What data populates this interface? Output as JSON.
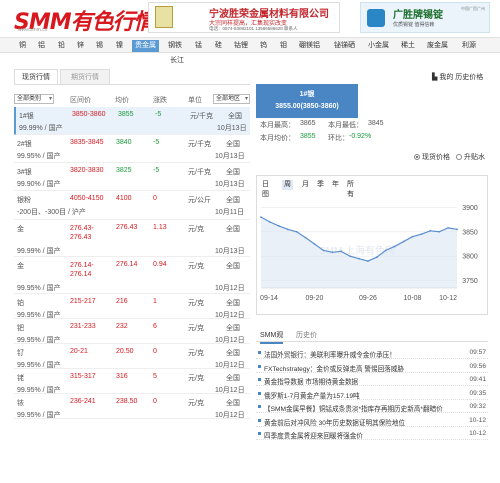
{
  "header": {
    "logo": "SMM有色行情",
    "logo_sub": "www.smm.cn",
    "ad1_title": "宁波胜荣金属材料有限公司",
    "ad1_slogan": "大宗同样提高，汇集现实改变",
    "ad1_contact": "电话：0574-83082101 13586586628 联系人",
    "ad2_title": "广胜牌锡锭",
    "ad2_sub": "优质锡锭 值得信赖",
    "ad2_tag": "中国广西广州"
  },
  "nav": {
    "items": [
      "铜",
      "铝",
      "铅",
      "锌",
      "锡",
      "镍",
      "贵金属",
      "钢铁",
      "锰",
      "硅",
      "钴锂",
      "钨",
      "钼",
      "硼镁铝",
      "铋锑硒",
      "小金属",
      "稀土",
      "废金属",
      "利源"
    ],
    "sub": "长江"
  },
  "tabs": {
    "spot": "现货行情",
    "futures": "期货行情"
  },
  "favorite": "我的 历史价格",
  "table": {
    "category_select": "全部类别",
    "region_select": "全部地区",
    "headers": [
      "区间价",
      "均价",
      "涨跌",
      "单位",
      "日期"
    ],
    "rows": [
      {
        "name": "1#银",
        "range": "3850-3860",
        "avg": "3855",
        "chg": "-5",
        "unit": "元/千克",
        "region": "全国",
        "spec": "99.99% / 国产",
        "date": "10月13日",
        "selected": true,
        "dir": "down"
      },
      {
        "name": "2#银",
        "range": "3835-3845",
        "avg": "3840",
        "chg": "-5",
        "unit": "元/千克",
        "region": "全国",
        "spec": "99.95% / 国产",
        "date": "10月13日",
        "selected": false,
        "dir": "down"
      },
      {
        "name": "3#银",
        "range": "3820-3830",
        "avg": "3825",
        "chg": "-5",
        "unit": "元/千克",
        "region": "全国",
        "spec": "99.90% / 国产",
        "date": "10月13日",
        "selected": false,
        "dir": "down"
      },
      {
        "name": "银粉",
        "range": "4050-4150",
        "avg": "4100",
        "chg": "0",
        "unit": "元/公斤",
        "region": "全国",
        "spec": "-200目、-300目 / 沪产",
        "date": "10月11日",
        "selected": false,
        "dir": "flat"
      },
      {
        "name": "金",
        "range": "276.43-276.43",
        "avg": "276.43",
        "chg": "1.13",
        "unit": "元/克",
        "region": "全国",
        "spec": "99.99% / 国产",
        "date": "10月13日",
        "selected": false,
        "dir": "up"
      },
      {
        "name": "金",
        "range": "276.14-276.14",
        "avg": "276.14",
        "chg": "0.94",
        "unit": "元/克",
        "region": "全国",
        "spec": "99.95% / 国产",
        "date": "10月12日",
        "selected": false,
        "dir": "up"
      },
      {
        "name": "铂",
        "range": "215-217",
        "avg": "216",
        "chg": "1",
        "unit": "元/克",
        "region": "全国",
        "spec": "99.95% / 国产",
        "date": "10月12日",
        "selected": false,
        "dir": "up"
      },
      {
        "name": "钯",
        "range": "231-233",
        "avg": "232",
        "chg": "6",
        "unit": "元/克",
        "region": "全国",
        "spec": "99.95% / 国产",
        "date": "10月12日",
        "selected": false,
        "dir": "up"
      },
      {
        "name": "钌",
        "range": "20-21",
        "avg": "20.50",
        "chg": "0",
        "unit": "元/克",
        "region": "全国",
        "spec": "99.95% / 国产",
        "date": "10月12日",
        "selected": false,
        "dir": "flat"
      },
      {
        "name": "铑",
        "range": "315-317",
        "avg": "316",
        "chg": "5",
        "unit": "元/克",
        "region": "全国",
        "spec": "99.95% / 国产",
        "date": "10月12日",
        "selected": false,
        "dir": "up"
      },
      {
        "name": "铱",
        "range": "236-241",
        "avg": "238.50",
        "chg": "0",
        "unit": "元/克",
        "region": "全国",
        "spec": "99.95% / 国产",
        "date": "10月12日",
        "selected": false,
        "dir": "flat"
      }
    ]
  },
  "detail": {
    "name": "1#银",
    "price_line": "3855.00(3850-3860)",
    "high_label": "本月最高：",
    "high_value": "3865",
    "low_label": "本月最低：",
    "low_value": "3845",
    "avg_label": "本月均价：",
    "avg_value": "3855",
    "mom_label": "环比：",
    "mom_value": "-0.92%",
    "radio_spot": "现货价格",
    "radio_rise": "升贴水"
  },
  "chart_data": {
    "type": "line",
    "periods": [
      "日图",
      "周",
      "月",
      "季",
      "年",
      "所有"
    ],
    "active_period": "月",
    "x_ticks": [
      "09-14",
      "09-20",
      "09-26",
      "10-08",
      "10-12"
    ],
    "x": [
      "09-14",
      "09-15",
      "09-16",
      "09-17",
      "09-18",
      "09-19",
      "09-20",
      "09-21",
      "09-22",
      "09-23",
      "09-24",
      "09-25",
      "09-26",
      "09-27",
      "09-28",
      "09-29",
      "09-30",
      "10-08",
      "10-09",
      "10-10",
      "10-11",
      "10-12",
      "10-13"
    ],
    "values": [
      3880,
      3870,
      3862,
      3855,
      3850,
      3838,
      3825,
      3812,
      3808,
      3810,
      3800,
      3795,
      3790,
      3798,
      3812,
      3820,
      3830,
      3840,
      3845,
      3852,
      3850,
      3858,
      3855
    ],
    "y_ticks": [
      3750,
      3800,
      3850,
      3900
    ],
    "ylim": [
      3735,
      3915
    ],
    "watermark": "SMM 上海有色网",
    "line_color": "#5b8fd0",
    "grid": true
  },
  "news": {
    "tabs": [
      "SMM观",
      "历史价"
    ],
    "items": [
      {
        "title": "法国外贸银行：美联利率曝升威令金价承压！",
        "date": "09:57"
      },
      {
        "title": "FXTechstrategy：金价或反弹走高 警惕回落威胁",
        "date": "09:56"
      },
      {
        "title": "黄金指导数据 市场期待黄金数据",
        "date": "09:41"
      },
      {
        "title": "俄罗斯1-7月黄金产量为157.19吨",
        "date": "09:35"
      },
      {
        "title": "【SMM金属早餐】铜锰成条贵淡*指库存再期历史新高*翻暗价",
        "date": "09:32"
      },
      {
        "title": "黄金前后对冲风险 30年历史数据证明其保险地位",
        "date": "10-12"
      },
      {
        "title": "四季度贵金属将迎来回暖将强金价",
        "date": "10-12"
      }
    ]
  }
}
